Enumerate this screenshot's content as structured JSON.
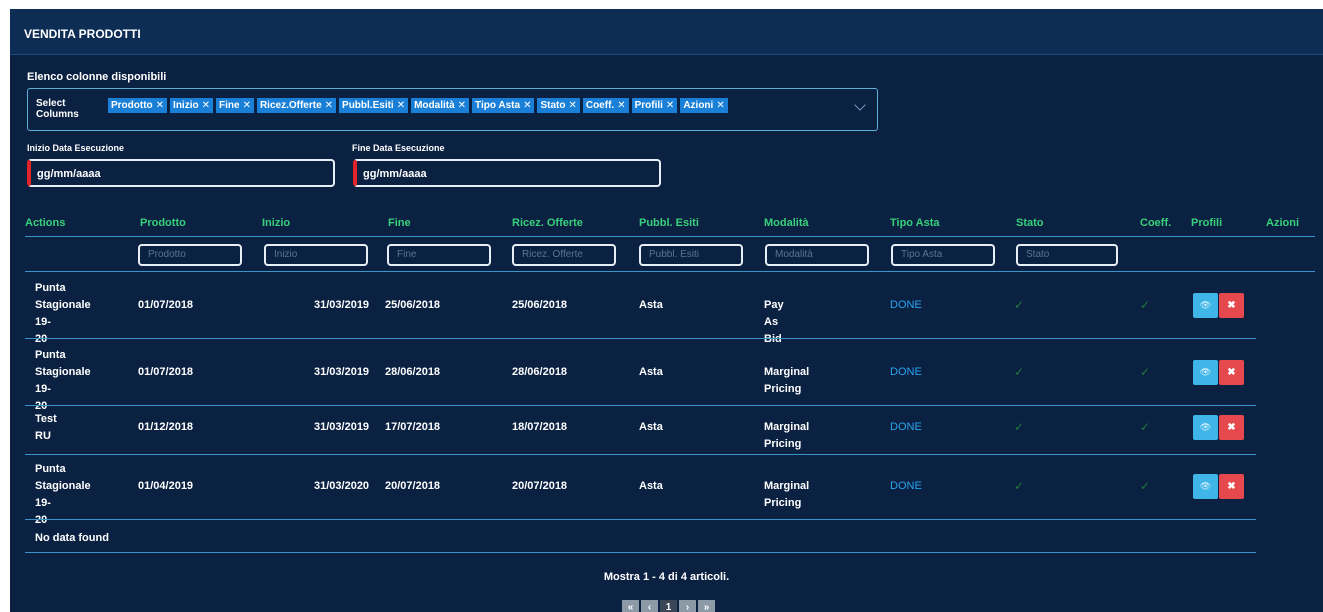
{
  "panel": {
    "title": "VENDITA PRODOTTI"
  },
  "columns_selector": {
    "label": "Elenco colonne disponibili",
    "select_label": "Select Columns",
    "tags": [
      "Prodotto",
      "Inizio",
      "Fine",
      "Ricez.Offerte",
      "Pubbl.Esiti",
      "Modalità",
      "Tipo Asta",
      "Stato",
      "Coeff.",
      "Profili",
      "Azioni"
    ]
  },
  "filters": {
    "start": {
      "label": "Inizio Data Esecuzione",
      "value": "gg/mm/aaaa"
    },
    "end": {
      "label": "Fine Data Esecuzione",
      "value": "gg/mm/aaaa"
    }
  },
  "table": {
    "headers": [
      "Actions",
      "Prodotto",
      "Inizio",
      "Fine",
      "Ricez. Offerte",
      "Pubbl. Esiti",
      "Modalità",
      "Tipo Asta",
      "Stato",
      "Coeff.",
      "Profili",
      "Azioni"
    ],
    "filter_placeholders": [
      "Prodotto",
      "Inizio",
      "Fine",
      "Ricez. Offerte",
      "Pubbl. Esiti",
      "Modalità",
      "Tipo Asta",
      "Stato"
    ],
    "rows": [
      {
        "name": [
          "Punta",
          "Stagionale 19-",
          "20"
        ],
        "prodotto": "01/07/2018",
        "inizio": "31/03/2019",
        "fine": "25/06/2018",
        "ricez": "25/06/2018",
        "pubbl": "Asta",
        "modalita": "Pay As Bid",
        "tipo": "DONE",
        "stato": "✓",
        "coeff": "✓"
      },
      {
        "name": [
          "Punta",
          "Stagionale 19-",
          "20"
        ],
        "prodotto": "01/07/2018",
        "inizio": "31/03/2019",
        "fine": "28/06/2018",
        "ricez": "28/06/2018",
        "pubbl": "Asta",
        "modalita": "Marginal Pricing",
        "tipo": "DONE",
        "stato": "✓",
        "coeff": "✓"
      },
      {
        "name": [
          "Test",
          "RU"
        ],
        "prodotto": "01/12/2018",
        "inizio": "31/03/2019",
        "fine": "17/07/2018",
        "ricez": "18/07/2018",
        "pubbl": "Asta",
        "modalita": "Marginal Pricing",
        "tipo": "DONE",
        "stato": "✓",
        "coeff": "✓"
      },
      {
        "name": [
          "Punta",
          "Stagionale 19-",
          "20"
        ],
        "prodotto": "01/04/2019",
        "inizio": "31/03/2020",
        "fine": "20/07/2018",
        "ricez": "20/07/2018",
        "pubbl": "Asta",
        "modalita": "Marginal Pricing",
        "tipo": "DONE",
        "stato": "✓",
        "coeff": "✓"
      }
    ],
    "empty_text": "No data found",
    "view_icon_glyph": "👁",
    "delete_icon_glyph": "✖"
  },
  "footer": {
    "summary": "Mostra 1 - 4 di 4 articoli."
  },
  "pagination": {
    "first": "«",
    "prev": "‹",
    "current": "1",
    "next": "›",
    "last": "»"
  },
  "icons": {
    "tag_remove": "close-icon",
    "dropdown": "chevron-down-icon",
    "view": "eye-icon",
    "delete": "delete-icon",
    "check": "check-icon"
  },
  "colors": {
    "background": "#0b2142",
    "header_text": "#38d07a",
    "done": "#2aa3ee",
    "view_button": "#3fb5e8",
    "delete_button": "#e5484d"
  }
}
